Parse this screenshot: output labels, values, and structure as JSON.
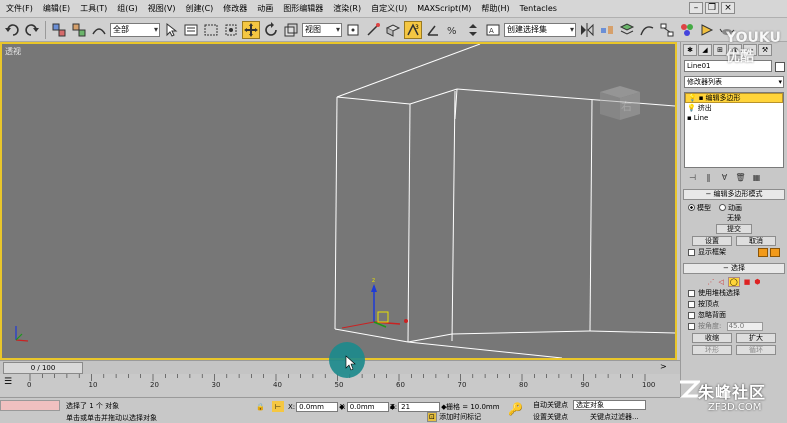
{
  "menu": {
    "items": [
      "文件(F)",
      "编辑(E)",
      "工具(T)",
      "组(G)",
      "视图(V)",
      "创建(C)",
      "修改器",
      "动画",
      "图形编辑器",
      "渲染(R)",
      "自定义(U)",
      "MAXScript(M)",
      "帮助(H)",
      "Tentacles"
    ]
  },
  "toolbar": {
    "selection_filter": "全部",
    "reference_coord": "视图",
    "named_selection": "创建选择集"
  },
  "viewport": {
    "label": "透视",
    "border_color": "#e9c62a",
    "bg_color": "#777777"
  },
  "command_panel": {
    "object_name": "Line01",
    "modifier_list": "修改器列表",
    "stack": [
      {
        "label": "编辑多边形",
        "selected": true
      },
      {
        "label": "挤出",
        "selected": false
      },
      {
        "label": "Line",
        "selected": false
      }
    ],
    "rollout_edit_poly": {
      "title": "编辑多边形模式",
      "mode_model": "模型",
      "mode_anim": "动画",
      "no_op": "无操",
      "commit": "提交",
      "settings": "设置",
      "cancel": "取消",
      "show_cage": "显示框架"
    },
    "rollout_select": {
      "title": "选择",
      "use_stack": "使用堆栈选择",
      "by_vertex": "按顶点",
      "ignore_back": "忽略背面",
      "by_angle": "按角度:",
      "angle_value": "45.0",
      "shrink": "收缩",
      "grow": "扩大",
      "ring": "环形",
      "loop": "循环"
    }
  },
  "timeline": {
    "slider_label": "0 / 100",
    "ticks": [
      "0",
      "10",
      "20",
      "30",
      "40",
      "50",
      "60",
      "70",
      "80",
      "90",
      "100"
    ]
  },
  "status": {
    "selected_text": "选择了 1 个 对象",
    "prompt_text": "单击或单击并拖动以选择对象",
    "x_label": "X:",
    "x_value": "0.0mm",
    "y_label": "Y:",
    "y_value": "0.0mm",
    "z_label": "Z:",
    "z_value": "21",
    "grid_text": "栅格 = 10.0mm",
    "add_time_tag": "添加时间标记",
    "auto_key": "自动关键点",
    "set_key": "设置关键点",
    "selected_object": "选定对象",
    "key_filter": "关键点过滤器..."
  },
  "watermark": {
    "text1": "朱峰社区",
    "text2": "ZF3D.COM",
    "youku": "YOUKU 优酷"
  },
  "colors": {
    "accent": "#f5c742",
    "stack_selected": "#ffd43a",
    "playhead_marker": "#1b8a8c"
  }
}
